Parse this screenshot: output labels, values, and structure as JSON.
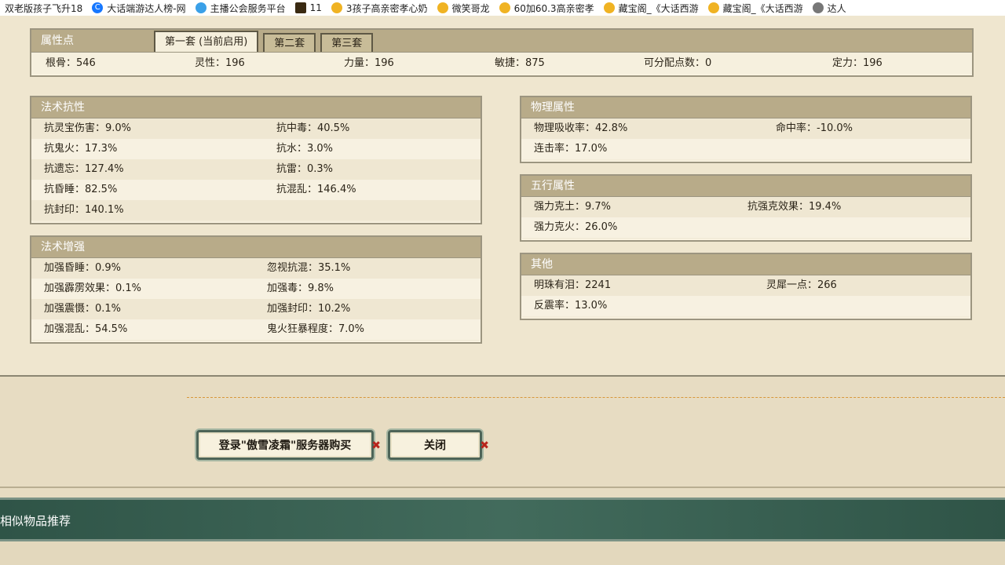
{
  "bookmarks": [
    {
      "label": "双老版孩子飞升18",
      "icon": "none"
    },
    {
      "label": "大话端游达人榜-网",
      "icon": "blue-c-icon"
    },
    {
      "label": "主播公会服务平台",
      "icon": "cloud-icon"
    },
    {
      "label": "11",
      "icon": "game-icon"
    },
    {
      "label": "3孩子高亲密孝心奶",
      "icon": "treasure-icon"
    },
    {
      "label": "微笑哥龙",
      "icon": "treasure-icon"
    },
    {
      "label": "60加60.3高亲密孝",
      "icon": "treasure-icon"
    },
    {
      "label": "藏宝阁_《大话西游",
      "icon": "treasure-icon"
    },
    {
      "label": "藏宝阁_《大话西游",
      "icon": "treasure-icon"
    },
    {
      "label": "达人",
      "icon": "globe-icon"
    }
  ],
  "attributes": {
    "title": "属性点",
    "tabs": [
      "第一套 (当前启用)",
      "第二套",
      "第三套"
    ],
    "values": [
      {
        "label": "根骨：546"
      },
      {
        "label": "灵性：196"
      },
      {
        "label": "力量：196"
      },
      {
        "label": "敏捷：875"
      },
      {
        "label": "可分配点数：0"
      },
      {
        "label": "定力：196"
      }
    ]
  },
  "magic_resist": {
    "title": "法术抗性",
    "rows": [
      [
        "抗灵宝伤害：9.0%",
        "抗中毒：40.5%"
      ],
      [
        "抗鬼火：17.3%",
        "抗水：3.0%"
      ],
      [
        "抗遗忘：127.4%",
        "抗雷：0.3%"
      ],
      [
        "抗昏睡：82.5%",
        "抗混乱：146.4%"
      ],
      [
        "抗封印：140.1%",
        ""
      ]
    ]
  },
  "magic_boost": {
    "title": "法术增强",
    "rows": [
      [
        "加强昏睡：0.9%",
        "忽视抗混：35.1%"
      ],
      [
        "加强霹雳效果：0.1%",
        "加强毒：9.8%"
      ],
      [
        "加强震慑：0.1%",
        "加强封印：10.2%"
      ],
      [
        "加强混乱：54.5%",
        "鬼火狂暴程度：7.0%"
      ]
    ]
  },
  "physical": {
    "title": "物理属性",
    "rows": [
      [
        "物理吸收率：42.8%",
        "命中率：-10.0%"
      ],
      [
        "连击率：17.0%",
        ""
      ]
    ]
  },
  "five_elements": {
    "title": "五行属性",
    "rows": [
      [
        "强力克土：9.7%",
        "抗强克效果：19.4%"
      ],
      [
        "强力克火：26.0%",
        ""
      ]
    ]
  },
  "other": {
    "title": "其他",
    "rows": [
      [
        "明珠有泪：2241",
        "灵犀一点：266"
      ],
      [
        "反震率：13.0%",
        ""
      ]
    ]
  },
  "buttons": {
    "buy": "登录\"傲雪凌霜\"服务器购买",
    "close": "关闭"
  },
  "recommend_title": "相似物品推荐"
}
